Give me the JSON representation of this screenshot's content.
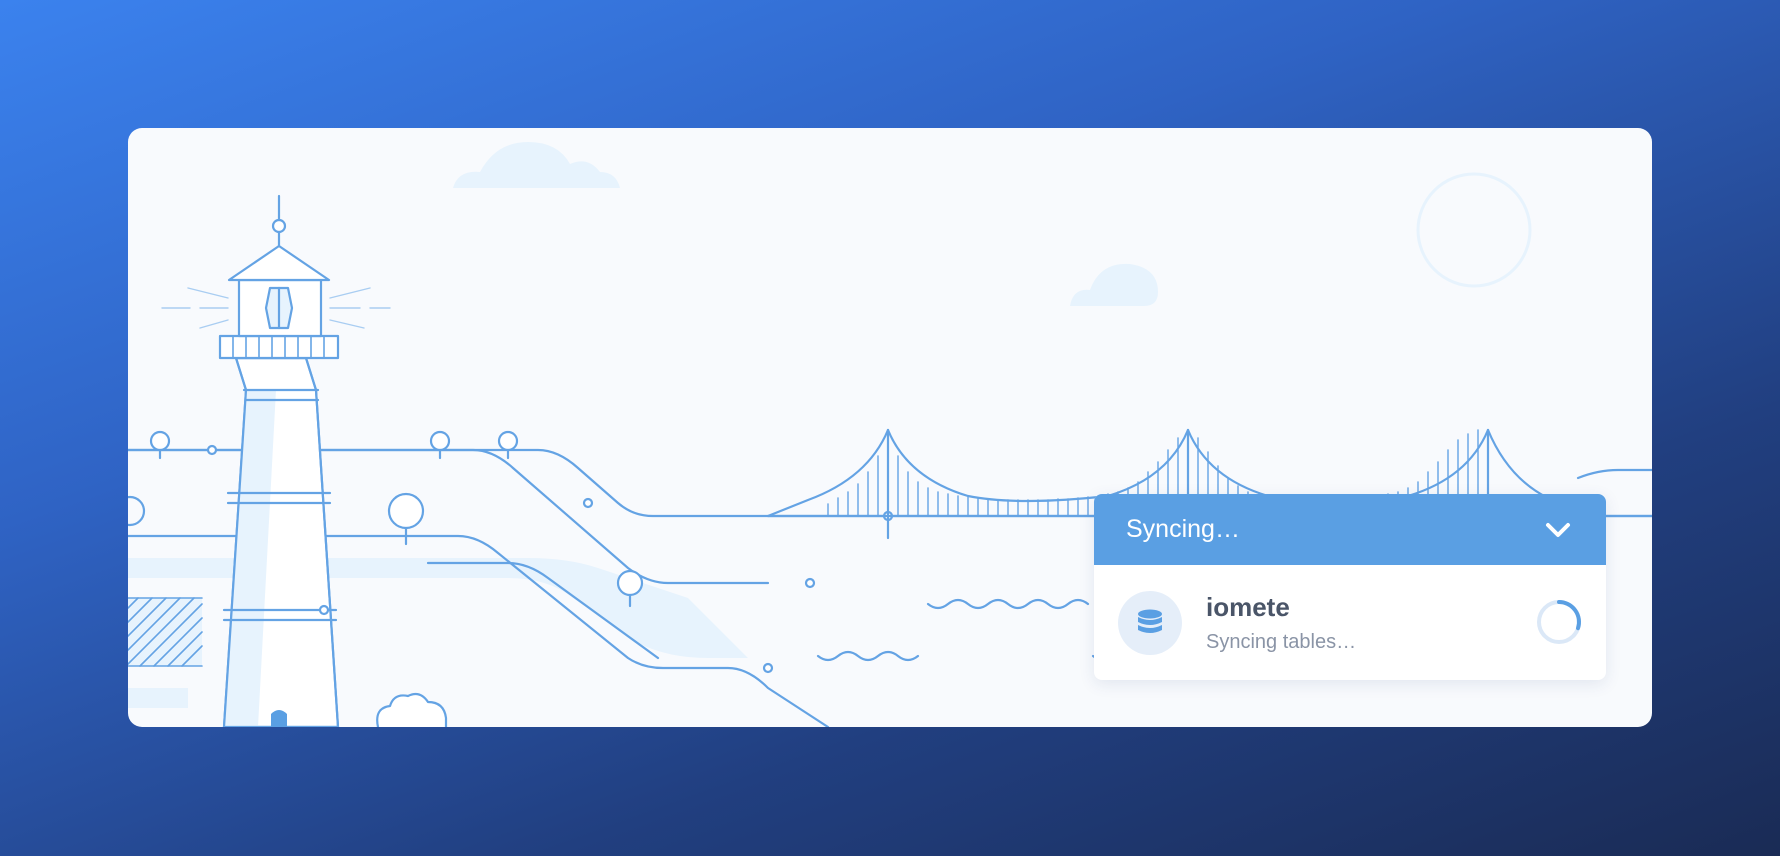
{
  "sync": {
    "title": "Syncing…",
    "item_name": "iomete",
    "item_status": "Syncing tables…",
    "progress": 0.3
  },
  "icons": {
    "collapse": "chevron-down-icon",
    "database": "database-icon",
    "spinner": "spinner-icon"
  },
  "colors": {
    "accent": "#5a9fe3",
    "line": "#64a3e4",
    "fill_light": "#e7f3fd"
  }
}
